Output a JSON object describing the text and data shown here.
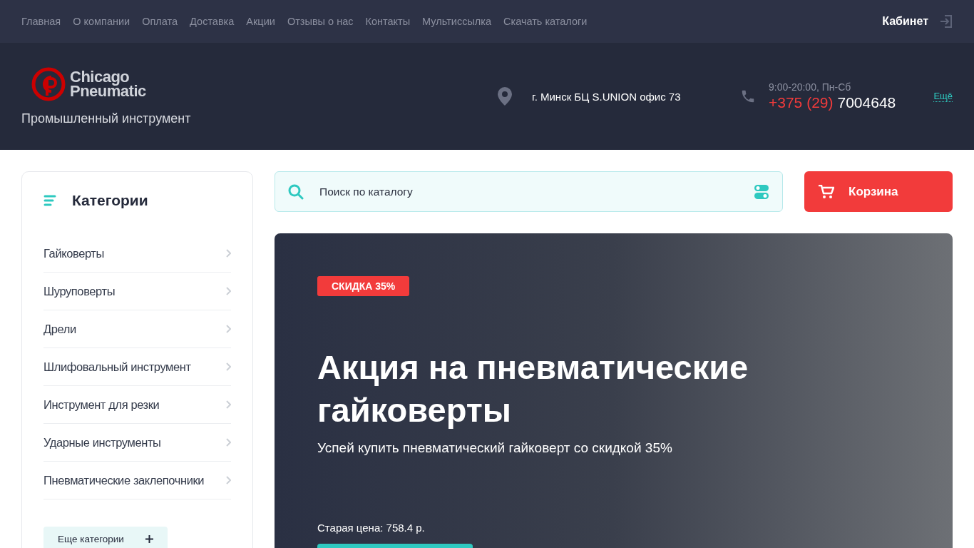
{
  "top_nav": {
    "links": [
      "Главная",
      "О компании",
      "Оплата",
      "Доставка",
      "Акции",
      "Отзывы о нас",
      "Контакты",
      "Мультиссылка",
      "Скачать каталоги"
    ],
    "account": "Кабинет"
  },
  "header": {
    "logo": {
      "line1": "Chicago",
      "line2": "Pneumatic"
    },
    "tagline": "Промышленный инструмент",
    "address": "г. Минск БЦ S.UNION офис 73",
    "hours": "9:00-20:00, Пн-Сб",
    "phone_code": "+375 (29)",
    "phone_number": "7004648",
    "more_link": "Ещё"
  },
  "sidebar": {
    "title": "Категории",
    "items": [
      "Гайковерты",
      "Шуруповерты",
      "Дрели",
      "Шлифовальный инструмент",
      "Инструмент для резки",
      "Ударные инструменты",
      "Пневматические заклепочники"
    ],
    "more_button": "Еще категории"
  },
  "search": {
    "placeholder": "Поиск по каталогу"
  },
  "cart": {
    "label": "Корзина"
  },
  "hero": {
    "badge": "СКИДКА 35%",
    "title": "Акция на пневматические гайковерты",
    "subtitle": "Успей купить пневматический гайковерт со скидкой 35%",
    "old_price": "Старая цена: 758.4 р."
  }
}
